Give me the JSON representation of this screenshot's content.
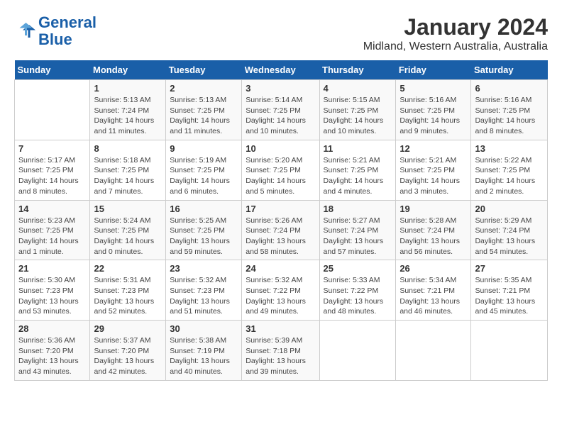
{
  "header": {
    "logo_line1": "General",
    "logo_line2": "Blue",
    "title": "January 2024",
    "subtitle": "Midland, Western Australia, Australia"
  },
  "columns": [
    "Sunday",
    "Monday",
    "Tuesday",
    "Wednesday",
    "Thursday",
    "Friday",
    "Saturday"
  ],
  "weeks": [
    [
      {
        "day": "",
        "info": ""
      },
      {
        "day": "1",
        "info": "Sunrise: 5:13 AM\nSunset: 7:24 PM\nDaylight: 14 hours\nand 11 minutes."
      },
      {
        "day": "2",
        "info": "Sunrise: 5:13 AM\nSunset: 7:25 PM\nDaylight: 14 hours\nand 11 minutes."
      },
      {
        "day": "3",
        "info": "Sunrise: 5:14 AM\nSunset: 7:25 PM\nDaylight: 14 hours\nand 10 minutes."
      },
      {
        "day": "4",
        "info": "Sunrise: 5:15 AM\nSunset: 7:25 PM\nDaylight: 14 hours\nand 10 minutes."
      },
      {
        "day": "5",
        "info": "Sunrise: 5:16 AM\nSunset: 7:25 PM\nDaylight: 14 hours\nand 9 minutes."
      },
      {
        "day": "6",
        "info": "Sunrise: 5:16 AM\nSunset: 7:25 PM\nDaylight: 14 hours\nand 8 minutes."
      }
    ],
    [
      {
        "day": "7",
        "info": "Sunrise: 5:17 AM\nSunset: 7:25 PM\nDaylight: 14 hours\nand 8 minutes."
      },
      {
        "day": "8",
        "info": "Sunrise: 5:18 AM\nSunset: 7:25 PM\nDaylight: 14 hours\nand 7 minutes."
      },
      {
        "day": "9",
        "info": "Sunrise: 5:19 AM\nSunset: 7:25 PM\nDaylight: 14 hours\nand 6 minutes."
      },
      {
        "day": "10",
        "info": "Sunrise: 5:20 AM\nSunset: 7:25 PM\nDaylight: 14 hours\nand 5 minutes."
      },
      {
        "day": "11",
        "info": "Sunrise: 5:21 AM\nSunset: 7:25 PM\nDaylight: 14 hours\nand 4 minutes."
      },
      {
        "day": "12",
        "info": "Sunrise: 5:21 AM\nSunset: 7:25 PM\nDaylight: 14 hours\nand 3 minutes."
      },
      {
        "day": "13",
        "info": "Sunrise: 5:22 AM\nSunset: 7:25 PM\nDaylight: 14 hours\nand 2 minutes."
      }
    ],
    [
      {
        "day": "14",
        "info": "Sunrise: 5:23 AM\nSunset: 7:25 PM\nDaylight: 14 hours\nand 1 minute."
      },
      {
        "day": "15",
        "info": "Sunrise: 5:24 AM\nSunset: 7:25 PM\nDaylight: 14 hours\nand 0 minutes."
      },
      {
        "day": "16",
        "info": "Sunrise: 5:25 AM\nSunset: 7:25 PM\nDaylight: 13 hours\nand 59 minutes."
      },
      {
        "day": "17",
        "info": "Sunrise: 5:26 AM\nSunset: 7:24 PM\nDaylight: 13 hours\nand 58 minutes."
      },
      {
        "day": "18",
        "info": "Sunrise: 5:27 AM\nSunset: 7:24 PM\nDaylight: 13 hours\nand 57 minutes."
      },
      {
        "day": "19",
        "info": "Sunrise: 5:28 AM\nSunset: 7:24 PM\nDaylight: 13 hours\nand 56 minutes."
      },
      {
        "day": "20",
        "info": "Sunrise: 5:29 AM\nSunset: 7:24 PM\nDaylight: 13 hours\nand 54 minutes."
      }
    ],
    [
      {
        "day": "21",
        "info": "Sunrise: 5:30 AM\nSunset: 7:23 PM\nDaylight: 13 hours\nand 53 minutes."
      },
      {
        "day": "22",
        "info": "Sunrise: 5:31 AM\nSunset: 7:23 PM\nDaylight: 13 hours\nand 52 minutes."
      },
      {
        "day": "23",
        "info": "Sunrise: 5:32 AM\nSunset: 7:23 PM\nDaylight: 13 hours\nand 51 minutes."
      },
      {
        "day": "24",
        "info": "Sunrise: 5:32 AM\nSunset: 7:22 PM\nDaylight: 13 hours\nand 49 minutes."
      },
      {
        "day": "25",
        "info": "Sunrise: 5:33 AM\nSunset: 7:22 PM\nDaylight: 13 hours\nand 48 minutes."
      },
      {
        "day": "26",
        "info": "Sunrise: 5:34 AM\nSunset: 7:21 PM\nDaylight: 13 hours\nand 46 minutes."
      },
      {
        "day": "27",
        "info": "Sunrise: 5:35 AM\nSunset: 7:21 PM\nDaylight: 13 hours\nand 45 minutes."
      }
    ],
    [
      {
        "day": "28",
        "info": "Sunrise: 5:36 AM\nSunset: 7:20 PM\nDaylight: 13 hours\nand 43 minutes."
      },
      {
        "day": "29",
        "info": "Sunrise: 5:37 AM\nSunset: 7:20 PM\nDaylight: 13 hours\nand 42 minutes."
      },
      {
        "day": "30",
        "info": "Sunrise: 5:38 AM\nSunset: 7:19 PM\nDaylight: 13 hours\nand 40 minutes."
      },
      {
        "day": "31",
        "info": "Sunrise: 5:39 AM\nSunset: 7:18 PM\nDaylight: 13 hours\nand 39 minutes."
      },
      {
        "day": "",
        "info": ""
      },
      {
        "day": "",
        "info": ""
      },
      {
        "day": "",
        "info": ""
      }
    ]
  ]
}
